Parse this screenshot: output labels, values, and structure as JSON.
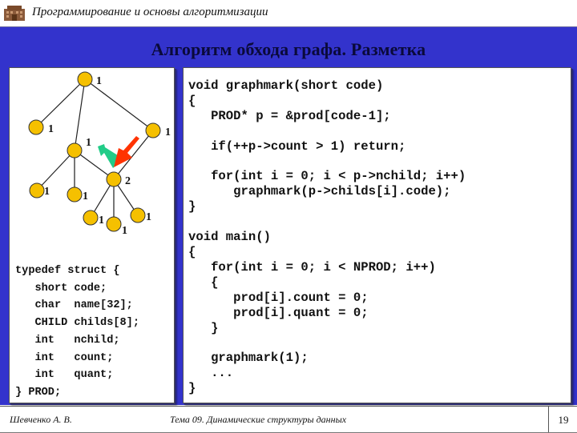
{
  "header": {
    "course_title": "Программирование и основы алгоритмизации",
    "logo_icon": "building-logo-icon"
  },
  "slide": {
    "title": "Алгоритм обхода графа. Разметка"
  },
  "graph": {
    "node_color": "#f5c000",
    "edge_color": "#222222",
    "highlight_arrow_red": "#ff3300",
    "highlight_arrow_green": "#22cc88",
    "nodes": [
      {
        "id": "root",
        "label": "1"
      },
      {
        "id": "a",
        "label": "1"
      },
      {
        "id": "b",
        "label": "1"
      },
      {
        "id": "c",
        "label": "1"
      },
      {
        "id": "d",
        "label": "2"
      },
      {
        "id": "e",
        "label": "1"
      },
      {
        "id": "f",
        "label": "1"
      },
      {
        "id": "g",
        "label": "1"
      },
      {
        "id": "h",
        "label": "1"
      },
      {
        "id": "i",
        "label": "1"
      }
    ],
    "edges": [
      [
        "root",
        "a"
      ],
      [
        "root",
        "c"
      ],
      [
        "root",
        "b"
      ],
      [
        "c",
        "e"
      ],
      [
        "c",
        "f"
      ],
      [
        "c",
        "d"
      ],
      [
        "b",
        "d"
      ],
      [
        "d",
        "g"
      ],
      [
        "d",
        "h"
      ],
      [
        "d",
        "i"
      ]
    ]
  },
  "struct_code": "typedef struct {\n   short code;\n   char  name[32];\n   CHILD childs[8];\n   int   nchild;\n   int   count;\n   int   quant;\n} PROD;",
  "main_code": "void graphmark(short code)\n{\n   PROD* p = &prod[code-1];\n\n   if(++p->count > 1) return;\n\n   for(int i = 0; i < p->nchild; i++)\n      graphmark(p->childs[i].code);\n}\n\nvoid main()\n{\n   for(int i = 0; i < NPROD; i++)\n   {\n      prod[i].count = 0;\n      prod[i].quant = 0;\n   }\n\n   graphmark(1);\n   ...\n}",
  "footer": {
    "author": "Шевченко А. В.",
    "topic": "Тема 09. Динамические структуры данных",
    "page_number": "19"
  }
}
